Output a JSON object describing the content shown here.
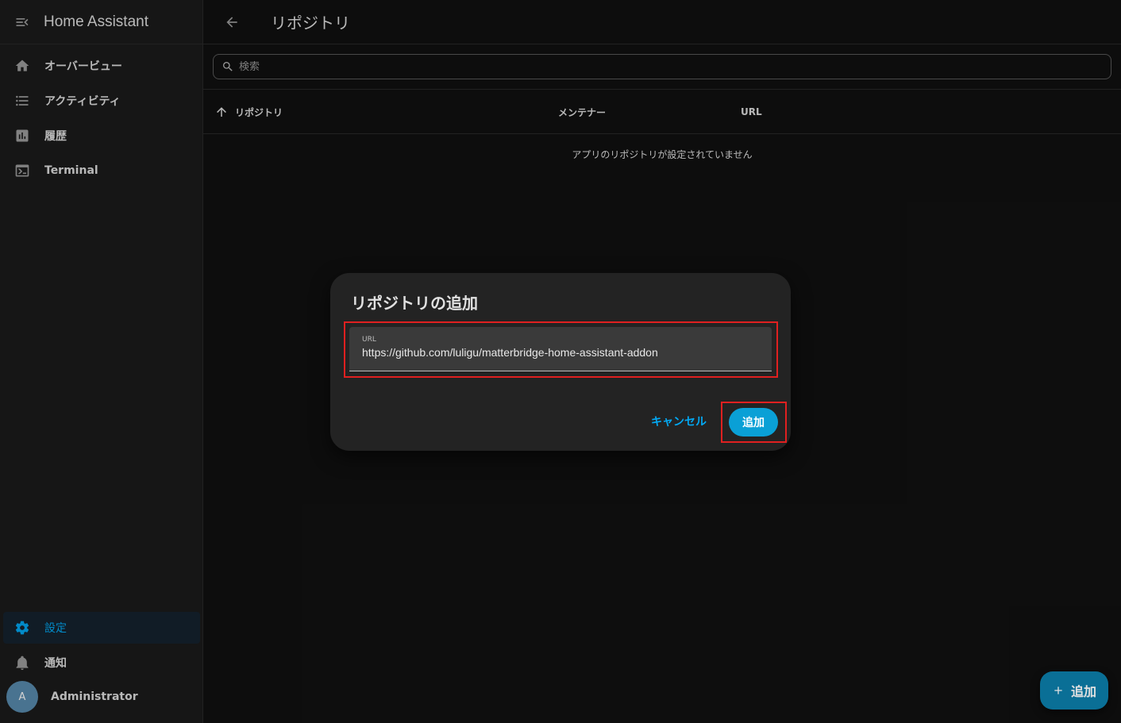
{
  "sidebar": {
    "app_title": "Home Assistant",
    "items": [
      {
        "label": "オーバービュー",
        "icon": "home-icon"
      },
      {
        "label": "アクティビティ",
        "icon": "list-icon"
      },
      {
        "label": "履歴",
        "icon": "chart-box-icon"
      },
      {
        "label": "Terminal",
        "icon": "console-icon"
      }
    ],
    "settings_label": "設定",
    "notifications_label": "通知",
    "user": {
      "initial": "A",
      "name": "Administrator"
    }
  },
  "header": {
    "title": "リポジトリ"
  },
  "search": {
    "placeholder": "検索"
  },
  "table": {
    "columns": [
      "リポジトリ",
      "メンテナー",
      "URL"
    ],
    "sort_icon": "arrow-up-icon",
    "empty_message": "アプリのリポジトリが設定されていません"
  },
  "dialog": {
    "title": "リポジトリの追加",
    "url_label": "URL",
    "url_value": "https://github.com/luligu/matterbridge-home-assistant-addon",
    "cancel_label": "キャンセル",
    "add_label": "追加"
  },
  "fab": {
    "label": "追加"
  },
  "colors": {
    "accent": "#03a9f4",
    "primary_button": "#0aa0d6",
    "fab": "#0a6f96",
    "highlight_box": "#e02020"
  }
}
